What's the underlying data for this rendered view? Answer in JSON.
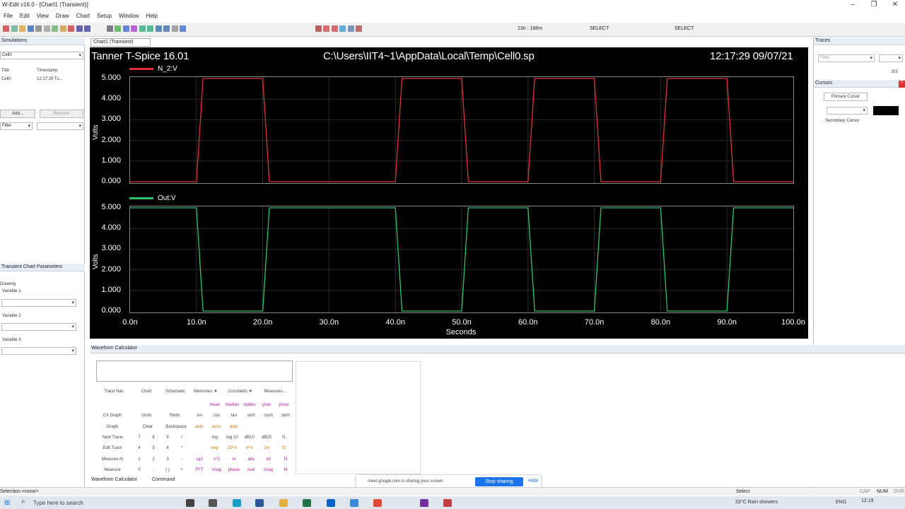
{
  "window": {
    "title": "W-Edit v16.0 - [Chart1 (Transient)]",
    "controls": [
      "–",
      "❐",
      "✕"
    ]
  },
  "menu": [
    "File",
    "Edit",
    "View",
    "Draw",
    "Chart",
    "Setup",
    "Window",
    "Help"
  ],
  "toolbar": {
    "range": "13n : 188m",
    "select1": "SELECT",
    "select2": "SELECT"
  },
  "left_panel": {
    "simulations_title": "Simulations",
    "combo_value": "Cell0",
    "col_title": "Title",
    "col_timestamp": "Timestamp",
    "row_title": "Cell0",
    "row_timestamp": "12:17:29 Tu...",
    "add_button": "Add...",
    "remove_button": "Remove",
    "filter_label": "Filter",
    "params_title": "Transient Chart Parameters",
    "drawing_label": "Drawing",
    "variable1": "Variable 1",
    "variable2": "Variable 2",
    "variable3": "Variable 3"
  },
  "chart_tab": "Chart1 (Transient)",
  "chart_header": {
    "left": "Tanner T-Spice 16.01",
    "center": "C:\\Users\\IIT4~1\\AppData\\Local\\Temp\\Cell0.sp",
    "right": "12:17:29 09/07/21"
  },
  "chart_data": [
    {
      "type": "line",
      "series": [
        {
          "name": "N_2:V",
          "color": "#e0303a"
        }
      ],
      "ylabel": "Volts",
      "ylim": [
        0,
        5
      ],
      "yticks": [
        "0.000",
        "1.000",
        "2.000",
        "3.000",
        "4.000",
        "5.000"
      ],
      "x": [
        0,
        10,
        11,
        20,
        21,
        40,
        41,
        50,
        51,
        60,
        61,
        70,
        71,
        80,
        81,
        90,
        91,
        100
      ],
      "values": [
        0,
        0,
        5,
        5,
        0,
        0,
        5,
        5,
        0,
        0,
        5,
        5,
        0,
        0,
        5,
        5,
        0,
        0
      ]
    },
    {
      "type": "line",
      "series": [
        {
          "name": "Out:V",
          "color": "#2fc36a"
        }
      ],
      "ylabel": "Volts",
      "ylim": [
        0,
        5
      ],
      "yticks": [
        "0.000",
        "1.000",
        "2.000",
        "3.000",
        "4.000",
        "5.000"
      ],
      "xlabel": "Seconds",
      "xticks": [
        "0.0n",
        "10.0n",
        "20.0n",
        "30.0n",
        "40.0n",
        "50.0n",
        "60.0n",
        "70.0n",
        "80.0n",
        "90.0n",
        "100.0n"
      ],
      "xlim": [
        0,
        100
      ],
      "x": [
        0,
        10,
        11,
        20,
        21,
        40,
        41,
        50,
        51,
        60,
        61,
        70,
        71,
        80,
        81,
        90,
        91,
        100
      ],
      "values": [
        5,
        5,
        0,
        0,
        5,
        5,
        0,
        0,
        5,
        5,
        0,
        0,
        5,
        5,
        0,
        0,
        5,
        5
      ]
    }
  ],
  "right_panel": {
    "traces_title": "Traces",
    "filter_placeholder": "Filter",
    "count": "3/3",
    "cursors_title": "Cursors",
    "primary_cursor": "Primary Cursor",
    "secondary_cursor": "Secondary Cursor"
  },
  "calculator": {
    "title": "Waveform Calculator",
    "top_buttons": [
      "Trace Nav",
      "Chart",
      "Schematic",
      "Memories ▼",
      "Constants ▼",
      "Measures..."
    ],
    "left_col": [
      "Clr Graph",
      "Graph",
      "New Trace",
      "Edit Trace",
      "Measure At",
      "Measure"
    ],
    "keys_row1": [
      "Undo",
      "Redo"
    ],
    "keys_row2": [
      "Clear",
      "Backspace"
    ],
    "digits": [
      [
        "7",
        "8",
        "9",
        "/"
      ],
      [
        "4",
        "5",
        "6",
        "*"
      ],
      [
        "1",
        "2",
        "3",
        "-"
      ],
      [
        "0",
        ".",
        "( )",
        "+"
      ]
    ],
    "fn_row0": [
      "mean",
      "median",
      "stddev",
      "ymin",
      "ymax"
    ],
    "fn_row1": [
      "sin",
      "cos",
      "tan",
      "sinh",
      "cosh",
      "tanh"
    ],
    "fn_row2": [
      "asin",
      "acos",
      "atan"
    ],
    "fn_row3": [
      "log",
      "log 10",
      "dB10",
      "dB20",
      "f1"
    ],
    "fn_row4": [
      "exp",
      "10^x",
      "e^x",
      "1/x",
      "f2"
    ],
    "fn_row5": [
      "sqrt",
      "x^2",
      "re",
      "abs",
      "int",
      "f3"
    ],
    "fn_row6": [
      "FFT",
      "imag",
      "phase",
      "real",
      "imag",
      "f4"
    ],
    "tabs": [
      "Waveform Calculator",
      "Command"
    ]
  },
  "share_bar": {
    "text": "meet.google.com is sharing your screen.",
    "stop": "Stop sharing",
    "hide": "Hide"
  },
  "status": {
    "left": "Selection:<none>",
    "center": "Select",
    "right": [
      "CAP",
      "NUM",
      "OVR"
    ]
  },
  "taskbar": {
    "search_placeholder": "Type here to search",
    "weather": "33°C  Rain showers",
    "lang": "ENG",
    "time": "12:19"
  }
}
